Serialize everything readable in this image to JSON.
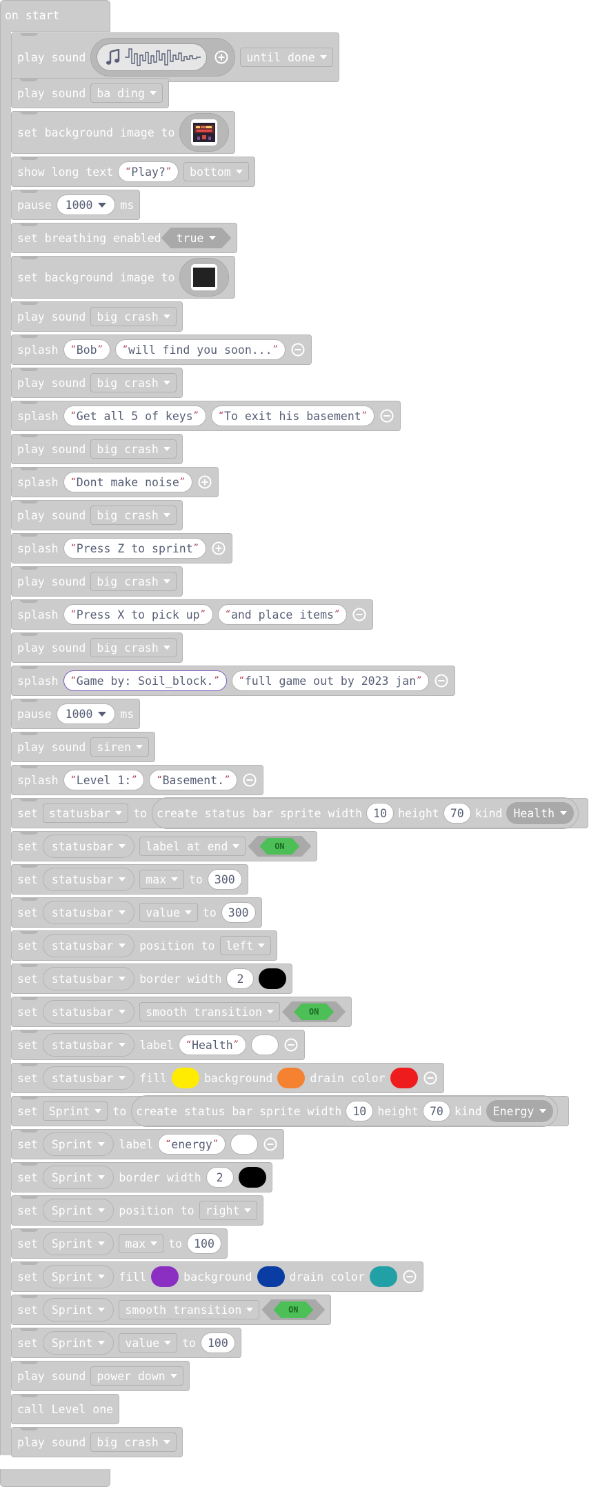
{
  "hat": {
    "label": "on start"
  },
  "rows": {
    "r01": {
      "label": "play sound",
      "mode": "until done"
    },
    "r02": {
      "label": "play sound",
      "sound": "ba ding"
    },
    "r03": {
      "label": "set background image to"
    },
    "r04": {
      "label": "show long text",
      "text": "Play?",
      "position": "bottom"
    },
    "r05": {
      "label": "pause",
      "value": "1000",
      "unit": "ms"
    },
    "r06": {
      "label": "set breathing enabled",
      "value": "true"
    },
    "r07": {
      "label": "set background image to"
    },
    "r08": {
      "label": "play sound",
      "sound": "big crash"
    },
    "r09": {
      "label": "splash",
      "title": "Bob",
      "subtitle": "will find you soon..."
    },
    "r10": {
      "label": "play sound",
      "sound": "big crash"
    },
    "r11": {
      "label": "splash",
      "title": "Get all 5 of keys",
      "subtitle": "To exit his basement"
    },
    "r12": {
      "label": "play sound",
      "sound": "big crash"
    },
    "r13": {
      "label": "splash",
      "title": "Dont make noise"
    },
    "r14": {
      "label": "play sound",
      "sound": "big crash"
    },
    "r15": {
      "label": "splash",
      "title": "Press Z to sprint"
    },
    "r16": {
      "label": "play sound",
      "sound": "big crash"
    },
    "r17": {
      "label": "splash",
      "title": "Press X to pick up",
      "subtitle": "and place items"
    },
    "r18": {
      "label": "play sound",
      "sound": "big crash"
    },
    "r19": {
      "label": "splash",
      "title": "Game by: Soil_block.",
      "subtitle": "full game out by 2023 jan"
    },
    "r20": {
      "label": "pause",
      "value": "1000",
      "unit": "ms"
    },
    "r21": {
      "label": "play sound",
      "sound": "siren"
    },
    "r22": {
      "label": "splash",
      "title": "Level 1:",
      "subtitle": "Basement."
    },
    "r23": {
      "label": "set",
      "var": "statusbar",
      "to": "to",
      "create": "create status bar sprite width",
      "width": "10",
      "height_label": "height",
      "height": "70",
      "kind_label": "kind",
      "kind": "Health"
    },
    "r24": {
      "label": "set",
      "var": "statusbar",
      "prop": "label at end",
      "toggle": "ON"
    },
    "r25": {
      "label": "set",
      "var": "statusbar",
      "prop": "max",
      "to": "to",
      "value": "300"
    },
    "r26": {
      "label": "set",
      "var": "statusbar",
      "prop": "value",
      "to": "to",
      "value": "300"
    },
    "r27": {
      "label": "set",
      "var": "statusbar",
      "text": "position to",
      "side": "left"
    },
    "r28": {
      "label": "set",
      "var": "statusbar",
      "text": "border width",
      "value": "2",
      "color": "#000000"
    },
    "r29": {
      "label": "set",
      "var": "statusbar",
      "prop": "smooth transition",
      "toggle": "ON"
    },
    "r30": {
      "label": "set",
      "var": "statusbar",
      "text": "label",
      "value": "Health",
      "color": "#ffffff"
    },
    "r31": {
      "label": "set",
      "var": "statusbar",
      "fill_label": "fill",
      "fill": "#ffec00",
      "bg_label": "background",
      "bg": "#f58231",
      "drain_label": "drain color",
      "drain": "#ee1c1c"
    },
    "r32": {
      "label": "set",
      "var": "Sprint",
      "to": "to",
      "create": "create status bar sprite width",
      "width": "10",
      "height_label": "height",
      "height": "70",
      "kind_label": "kind",
      "kind": "Energy"
    },
    "r33": {
      "label": "set",
      "var": "Sprint",
      "text": "label",
      "value": "energy",
      "color": "#ffffff"
    },
    "r34": {
      "label": "set",
      "var": "Sprint",
      "text": "border width",
      "value": "2",
      "color": "#000000"
    },
    "r35": {
      "label": "set",
      "var": "Sprint",
      "text": "position to",
      "side": "right"
    },
    "r36": {
      "label": "set",
      "var": "Sprint",
      "prop": "max",
      "to": "to",
      "value": "100"
    },
    "r37": {
      "label": "set",
      "var": "Sprint",
      "fill_label": "fill",
      "fill": "#8b2ec2",
      "bg_label": "background",
      "bg": "#0a3da3",
      "drain_label": "drain color",
      "drain": "#21a0a6"
    },
    "r38": {
      "label": "set",
      "var": "Sprint",
      "prop": "smooth transition",
      "toggle": "ON"
    },
    "r39": {
      "label": "set",
      "var": "Sprint",
      "prop": "value",
      "to": "to",
      "value": "100"
    },
    "r40": {
      "label": "play sound",
      "sound": "power down"
    },
    "r41": {
      "label": "call Level one"
    },
    "r42": {
      "label": "play sound",
      "sound": "big crash"
    }
  },
  "icons": {
    "note": "music-note-icon",
    "add": "add-circle-icon",
    "remove": "remove-circle-icon"
  },
  "colors": {
    "block": "#cccccc",
    "block_border": "#b5b5b5",
    "text": "#ffffff",
    "field_text": "#575e75",
    "quote": "#a32a3f",
    "toggle_on": "#4cbf56"
  }
}
